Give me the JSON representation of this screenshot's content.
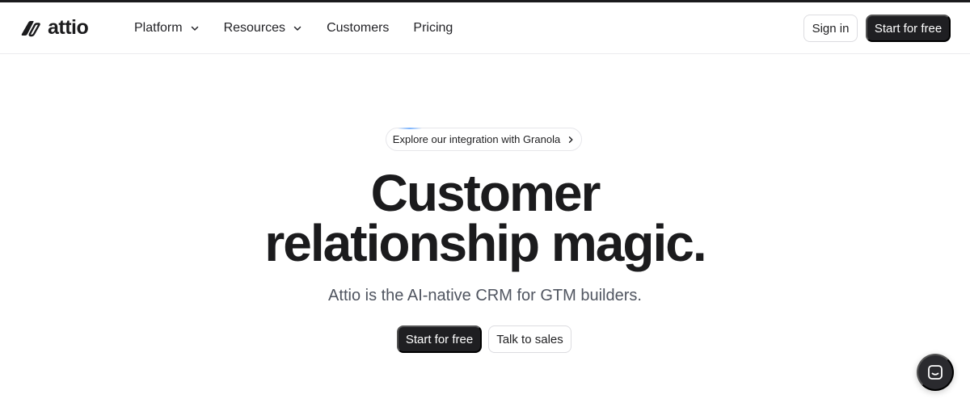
{
  "brand": {
    "name": "attio",
    "logo_icon": "attio-logo-icon"
  },
  "nav": {
    "items": [
      {
        "label": "Platform",
        "has_dropdown": true
      },
      {
        "label": "Resources",
        "has_dropdown": true
      },
      {
        "label": "Customers",
        "has_dropdown": false
      },
      {
        "label": "Pricing",
        "has_dropdown": false
      }
    ]
  },
  "header_actions": {
    "sign_in_label": "Sign in",
    "start_label": "Start for free"
  },
  "hero": {
    "announcement": "Explore our integration with Granola",
    "headline_line1": "Customer",
    "headline_line2": "relationship magic.",
    "subheadline": "Attio is the AI-native CRM for GTM builders.",
    "cta_primary": "Start for free",
    "cta_secondary": "Talk to sales"
  },
  "chat_widget": {
    "icon": "chat-icon"
  },
  "colors": {
    "dark": "#1f1f22",
    "text_muted": "#505560",
    "border": "#dcdce0"
  }
}
